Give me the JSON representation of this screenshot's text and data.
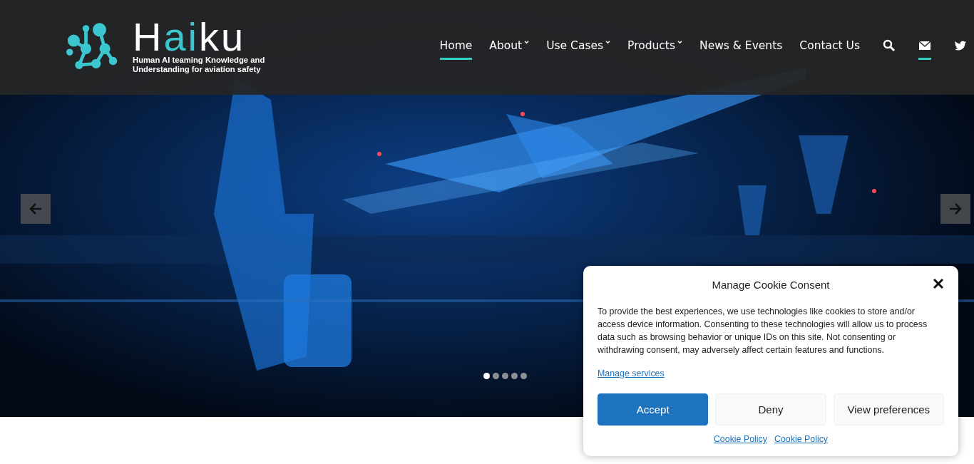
{
  "logo": {
    "wordmark": [
      {
        "text": "H",
        "accent": false
      },
      {
        "text": "ai",
        "accent": true
      },
      {
        "text": "ku",
        "accent": false
      }
    ],
    "tagline": "Human AI teaming Knowledge and Understanding for aviation safety"
  },
  "nav": [
    {
      "label": "Home",
      "dropdown": false,
      "selected": true
    },
    {
      "label": "About",
      "dropdown": true,
      "selected": false
    },
    {
      "label": "Use Cases",
      "dropdown": true,
      "selected": false
    },
    {
      "label": "Products",
      "dropdown": true,
      "selected": false
    },
    {
      "label": "News & Events",
      "dropdown": false,
      "selected": false
    },
    {
      "label": "Contact Us",
      "dropdown": false,
      "selected": false
    }
  ],
  "nav_icons": [
    {
      "kind": "search",
      "selected": false
    },
    {
      "kind": "mail",
      "selected": true
    },
    {
      "kind": "twitter",
      "selected": false
    }
  ],
  "slider": {
    "dots": [
      {
        "selected": true
      },
      {
        "selected": false
      },
      {
        "selected": false
      },
      {
        "selected": false
      },
      {
        "selected": false
      }
    ]
  },
  "cookie": {
    "title": "Manage Cookie Consent",
    "body": "To provide the best experiences, we use technologies like cookies to store and/or access device information. Consenting to these technologies will allow us to process data such as browsing behavior or unique IDs on this site. Not consenting or withdrawing consent, may adversely affect certain features and functions.",
    "manage_link": "Manage services",
    "buttons": [
      {
        "label": "Accept",
        "kind": "primary"
      },
      {
        "label": "Deny",
        "kind": "secondary"
      },
      {
        "label": "View preferences",
        "kind": "secondary"
      }
    ],
    "links": [
      "Cookie Policy",
      "Cookie Policy"
    ]
  }
}
